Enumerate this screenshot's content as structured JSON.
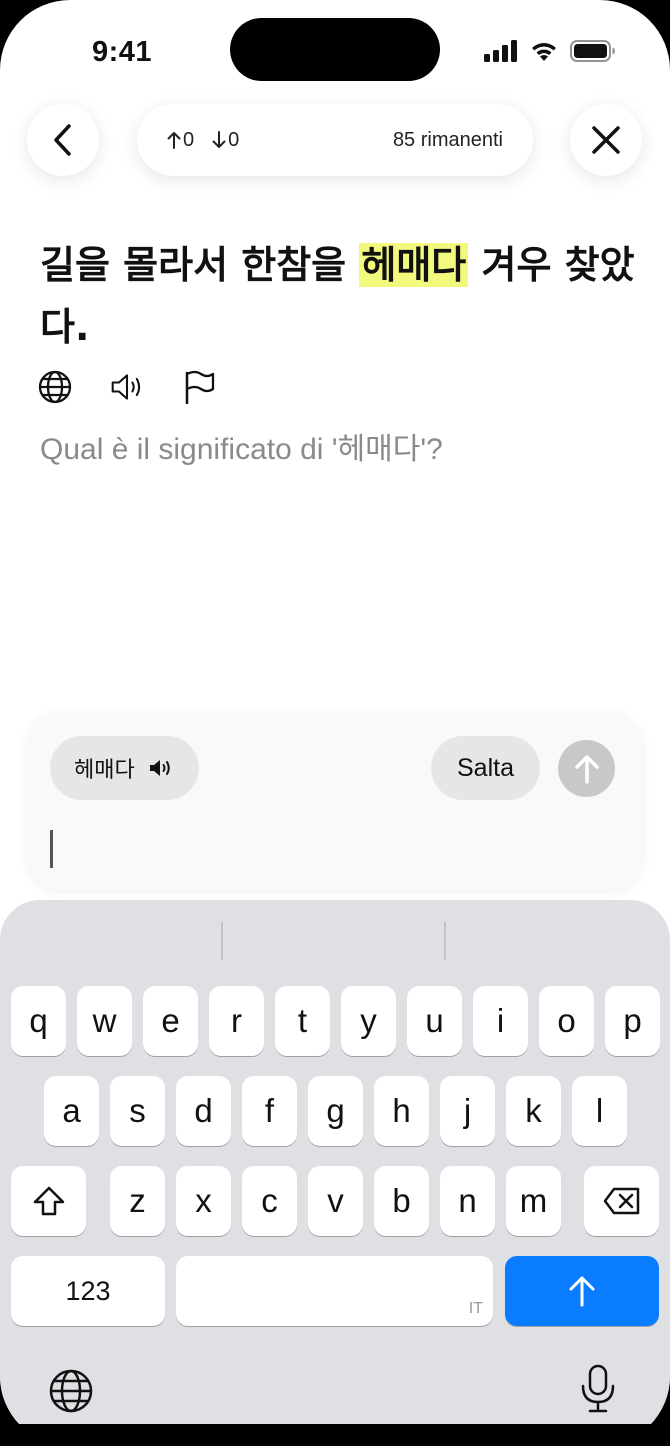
{
  "status_bar": {
    "time": "9:41"
  },
  "nav": {
    "back_icon": "chevron-left-icon",
    "close_icon": "close-icon",
    "up_count": "0",
    "down_count": "0",
    "remaining": "85 rimanenti"
  },
  "exercise": {
    "sentence_before": "길을 몰라서 한참을 ",
    "sentence_highlight": "헤매다",
    "sentence_after": " 겨우 찾았다.",
    "question": "Qual è il significato di '헤매다'?",
    "tools": [
      "globe-icon",
      "speaker-icon",
      "flag-icon"
    ]
  },
  "answer": {
    "hint_word": "헤매다",
    "skip_label": "Salta",
    "input_value": ""
  },
  "keyboard": {
    "row1": [
      "q",
      "w",
      "e",
      "r",
      "t",
      "y",
      "u",
      "i",
      "o",
      "p"
    ],
    "row2": [
      "a",
      "s",
      "d",
      "f",
      "g",
      "h",
      "j",
      "k",
      "l"
    ],
    "row3": [
      "z",
      "x",
      "c",
      "v",
      "b",
      "n",
      "m"
    ],
    "numbers_label": "123",
    "space_lang": "IT",
    "colors": {
      "return": "#0a7cff",
      "highlight": "#f3f97c",
      "background": "#dfe0e4"
    }
  }
}
